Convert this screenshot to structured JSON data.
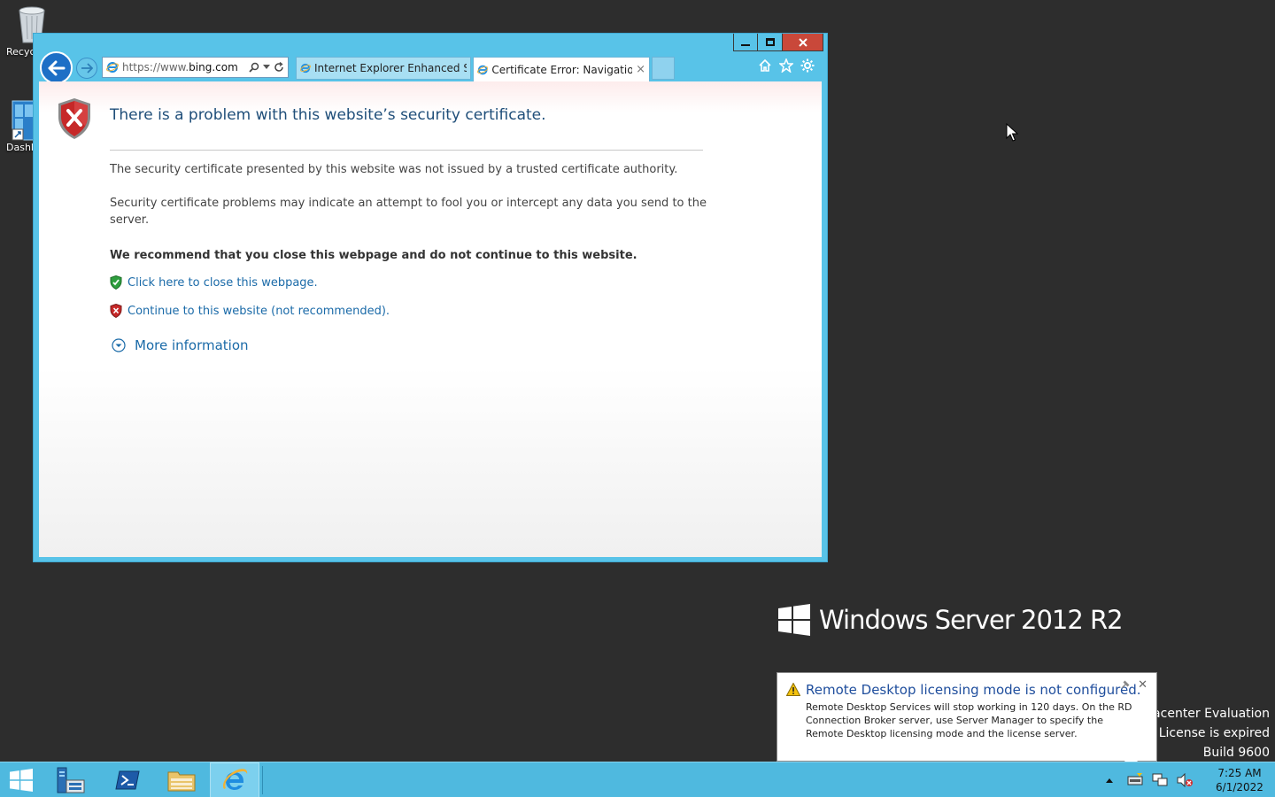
{
  "desktop": {
    "icons": [
      {
        "label": "Recyc",
        "icon": "recycle-bin-icon"
      },
      {
        "label": "Dashl",
        "icon": "dashboard-shortcut-icon"
      }
    ]
  },
  "browser": {
    "address": {
      "url_prefix": "https://www.",
      "url_domain": "bing.com",
      "url_suffix": "/"
    },
    "tabs": [
      {
        "label": "Internet Explorer Enhanced Sec...",
        "active": false
      },
      {
        "label": "Certificate Error: Navigation...",
        "active": true
      }
    ],
    "tab_close": "×",
    "page": {
      "title": "There is a problem with this website’s security certificate.",
      "p1": "The security certificate presented by this website was not issued by a trusted certificate authority.",
      "p2": "Security certificate problems may indicate an attempt to fool you or intercept any data you send to the server.",
      "recommend": "We recommend that you close this webpage and do not continue to this website.",
      "close_link": "Click here to close this webpage.",
      "continue_link": "Continue to this website (not recommended).",
      "more_info": "More information"
    }
  },
  "branding": {
    "text": "Windows Server 2012 R2"
  },
  "watermark": {
    "line1": "tacenter Evaluation",
    "line2": "s License is expired",
    "line3": "Build 9600"
  },
  "notification": {
    "title": "Remote Desktop licensing mode is not configured.",
    "body": "Remote Desktop Services will stop working in 120 days. On the RD Connection Broker server, use Server Manager to specify the Remote Desktop licensing mode and the license server.",
    "close": "✕"
  },
  "taskbar": {
    "items": [
      "start-button",
      "server-manager",
      "powershell",
      "file-explorer",
      "internet-explorer"
    ],
    "clock_time": "7:25 AM",
    "clock_date": "6/1/2022"
  },
  "colors": {
    "desktop_bg": "#2d2d2d",
    "window_frame": "#58c3e8",
    "taskbar": "#4fb9df",
    "link": "#1a6aa8",
    "title_blue": "#1f4e79",
    "close_red": "#c9483a"
  }
}
